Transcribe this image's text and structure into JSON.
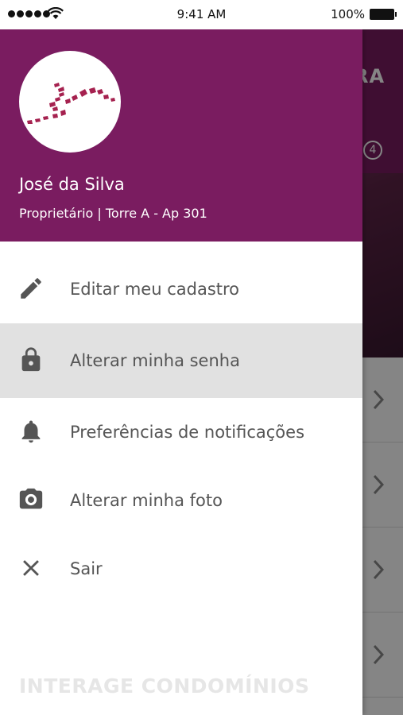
{
  "status_bar": {
    "time": "9:41 AM",
    "battery": "100%"
  },
  "background": {
    "header_fragment": "RA",
    "badge_count": "4"
  },
  "drawer": {
    "user_name": "José da Silva",
    "user_role": "Proprietário | Torre A - Ap 301",
    "menu": [
      {
        "label": "Editar meu cadastro",
        "icon": "pencil-icon"
      },
      {
        "label": "Alterar minha senha",
        "icon": "lock-icon",
        "selected": true
      },
      {
        "label": "Preferências de notificações",
        "icon": "bell-icon"
      },
      {
        "label": "Alterar minha foto",
        "icon": "camera-icon"
      },
      {
        "label": "Sair",
        "icon": "close-icon"
      }
    ],
    "footer": "INTERAGE CONDOMÍNIOS"
  },
  "colors": {
    "brand": "#7a1c60",
    "logo": "#a5214f",
    "selected_row": "#e1e1e1",
    "icon_gray": "#555555"
  }
}
